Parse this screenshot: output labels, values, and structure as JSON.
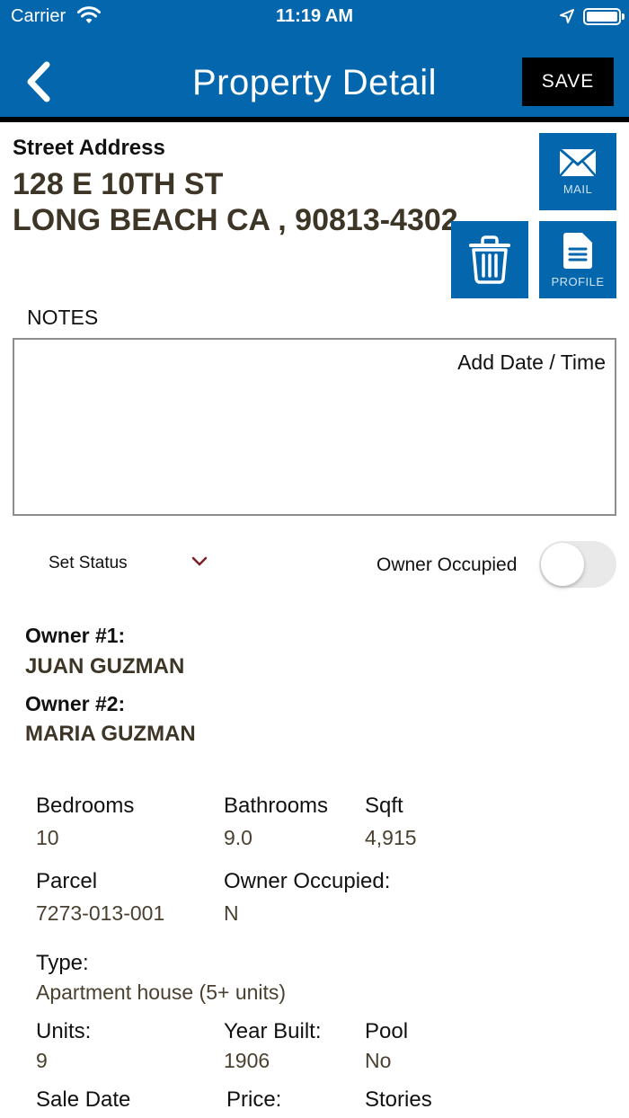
{
  "status_bar": {
    "carrier": "Carrier",
    "time": "11:19 AM"
  },
  "nav": {
    "title": "Property Detail",
    "save_label": "SAVE"
  },
  "address": {
    "label": "Street Address",
    "line1": "128  E  10TH ST",
    "line2": "LONG BEACH  CA , 90813-4302"
  },
  "actions": {
    "mail_label": "MAIL",
    "profile_label": "PROFILE"
  },
  "notes": {
    "label": "NOTES",
    "add_date_label": "Add Date / Time",
    "value": ""
  },
  "status": {
    "select_label": "Set Status",
    "owner_occupied_label": "Owner Occupied",
    "owner_occupied_on": false
  },
  "owners": {
    "owner1_label": "Owner #1:",
    "owner1_name": "JUAN GUZMAN",
    "owner2_label": "Owner #2:",
    "owner2_name": "MARIA GUZMAN"
  },
  "details": {
    "bedrooms_label": "Bedrooms",
    "bedrooms": "10",
    "bathrooms_label": "Bathrooms",
    "bathrooms": "9.0",
    "sqft_label": "Sqft",
    "sqft": "4,915",
    "parcel_label": "Parcel",
    "parcel": "7273-013-001",
    "owner_occupied_label": "Owner Occupied:",
    "owner_occupied": "N",
    "type_label": "Type:",
    "type": "Apartment house (5+ units)",
    "units_label": "Units:",
    "units": "9",
    "year_built_label": "Year Built:",
    "year_built": "1906",
    "pool_label": "Pool",
    "pool": "No",
    "sale_date_label": "Sale Date",
    "price_label": "Price:",
    "stories_label": "Stories"
  },
  "colors": {
    "brand_blue": "#0467ae",
    "value_brown": "#4a4030"
  }
}
